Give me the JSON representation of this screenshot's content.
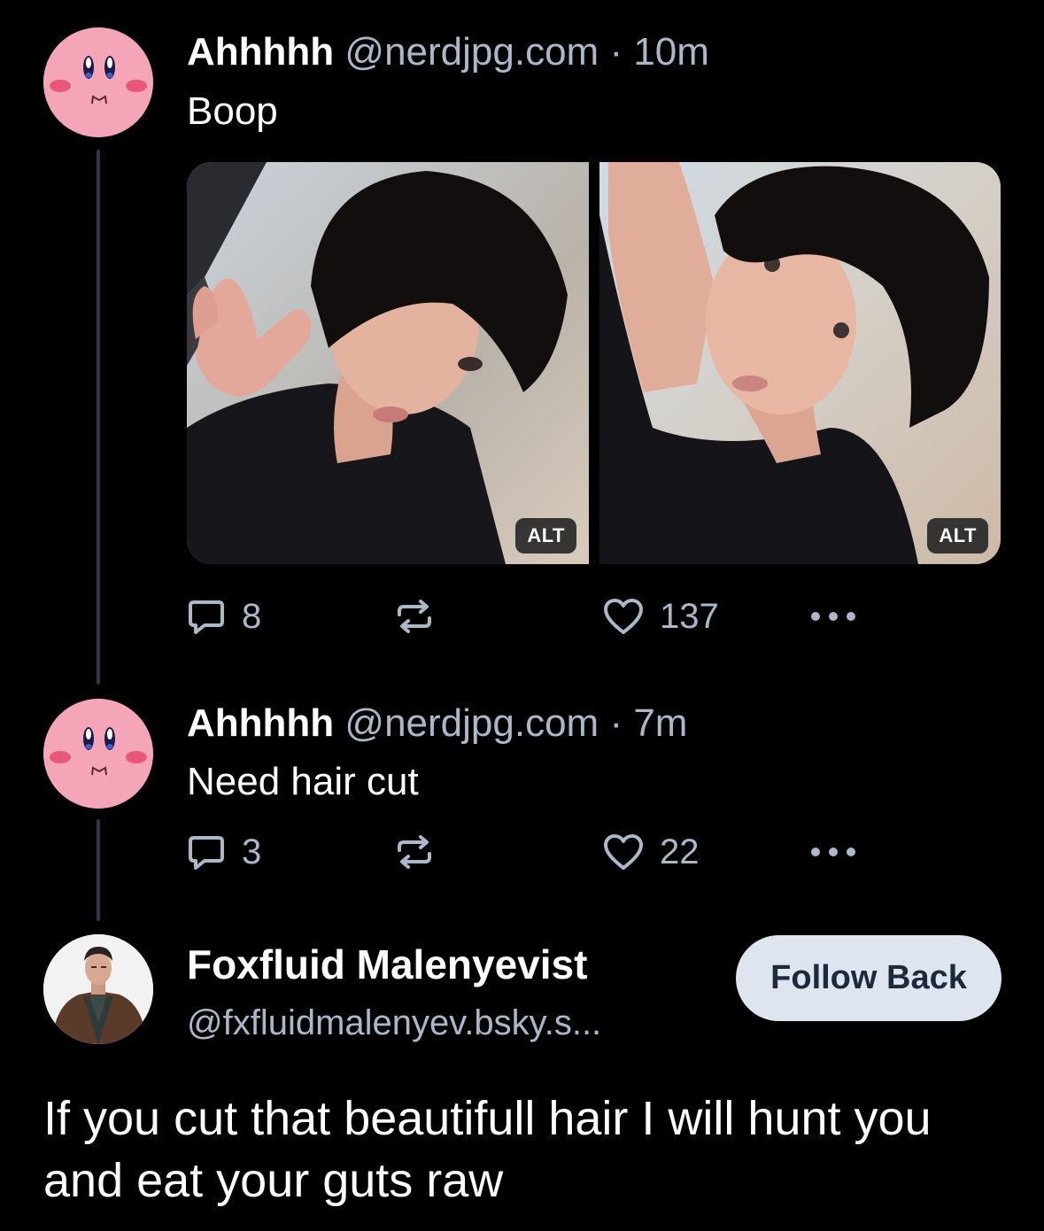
{
  "posts": [
    {
      "display_name": "Ahhhhh",
      "handle": "@nerdjpg.com",
      "time": "· 10m",
      "text": "Boop",
      "images": [
        {
          "alt_badge": "ALT"
        },
        {
          "alt_badge": "ALT"
        }
      ],
      "replies": "8",
      "likes": "137"
    },
    {
      "display_name": "Ahhhhh",
      "handle": "@nerdjpg.com",
      "time": "· 7m",
      "text": "Need hair cut",
      "replies": "3",
      "likes": "22"
    }
  ],
  "reply_author": {
    "display_name": "Foxfluid Malenyevist",
    "handle": "@fxfluidmalenyev.bsky.s...",
    "follow_label": "Follow Back"
  },
  "reply_text": "If you cut that beautifull hair I will hunt you and eat your guts raw",
  "icons": {
    "reply": "speech-bubble-icon",
    "repost": "repost-icon",
    "like": "heart-icon",
    "more": "more-dots-icon"
  },
  "colors": {
    "background": "#000000",
    "muted_text": "#aab8c8",
    "thread_line": "#2e3a4a",
    "avatar_pink": "#f4a6b8",
    "follow_button_bg": "#dfe5ee"
  }
}
